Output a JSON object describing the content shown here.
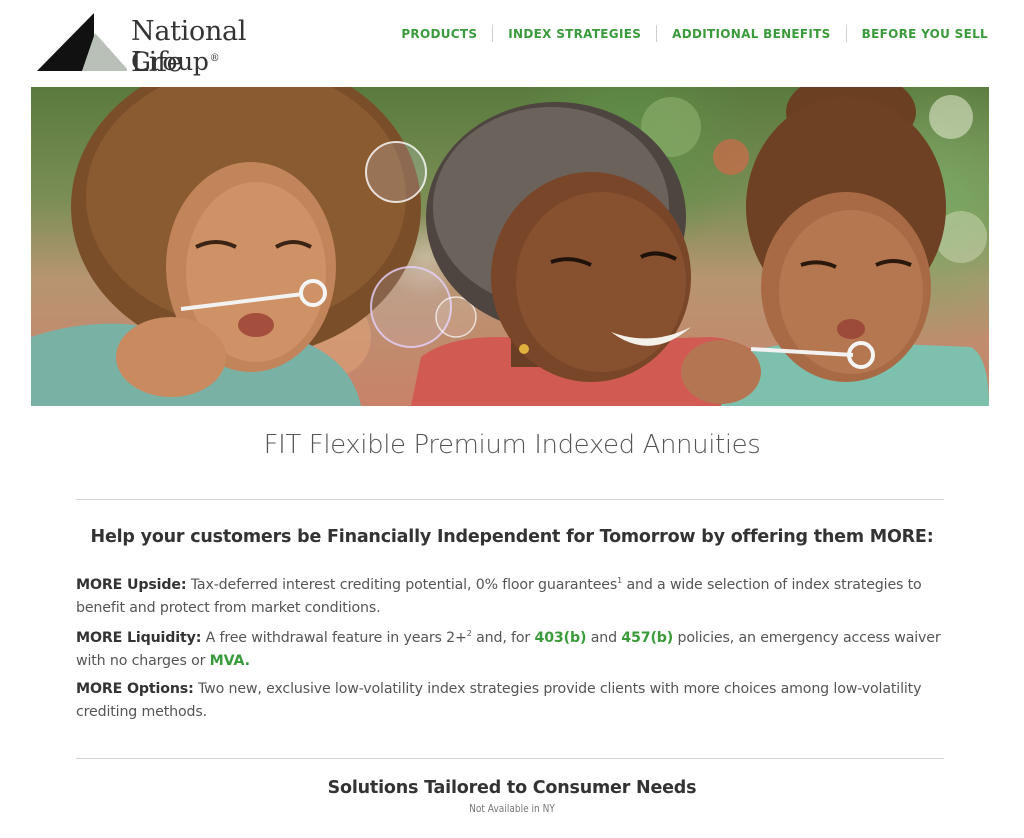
{
  "brand": {
    "logo_line1": "National Life",
    "logo_line2": "Group",
    "logo_reg": "®"
  },
  "nav": {
    "items": [
      {
        "label": "PRODUCTS"
      },
      {
        "label": "INDEX STRATEGIES"
      },
      {
        "label": "ADDITIONAL BENEFITS"
      },
      {
        "label": "BEFORE YOU SELL"
      }
    ]
  },
  "hero": {
    "icon": "photo-family-blowing-bubbles"
  },
  "main": {
    "title": "FIT Flexible Premium Indexed Annuities",
    "subhead": "Help your customers be Financially Independent for Tomorrow by offering them MORE:",
    "upside": {
      "label": "MORE Upside:",
      "text_a": " Tax-deferred interest crediting potential, 0% floor guarantees",
      "sup": "1",
      "text_b": " and a wide selection of index strategies to benefit and protect from market conditions."
    },
    "liquidity": {
      "label": "MORE Liquidity:",
      "text_a": " A free withdrawal feature in years 2+",
      "sup": "2",
      "text_b": " and, for ",
      "link_403b": "403(b)",
      "text_c": " and ",
      "link_457b": "457(b)",
      "text_d": " policies, an emergency access waiver with no charges or ",
      "link_mva": "MVA."
    },
    "options": {
      "label": "MORE Options:",
      "text": " Two new, exclusive low-volatility index strategies provide clients with more choices among low-volatility crediting methods."
    },
    "solutions_heading": "Solutions Tailored to Consumer Needs",
    "availability_note": "Not Available in NY"
  },
  "colors": {
    "accent_green": "#3b9a3b",
    "text": "#555555",
    "heading": "#333333"
  }
}
